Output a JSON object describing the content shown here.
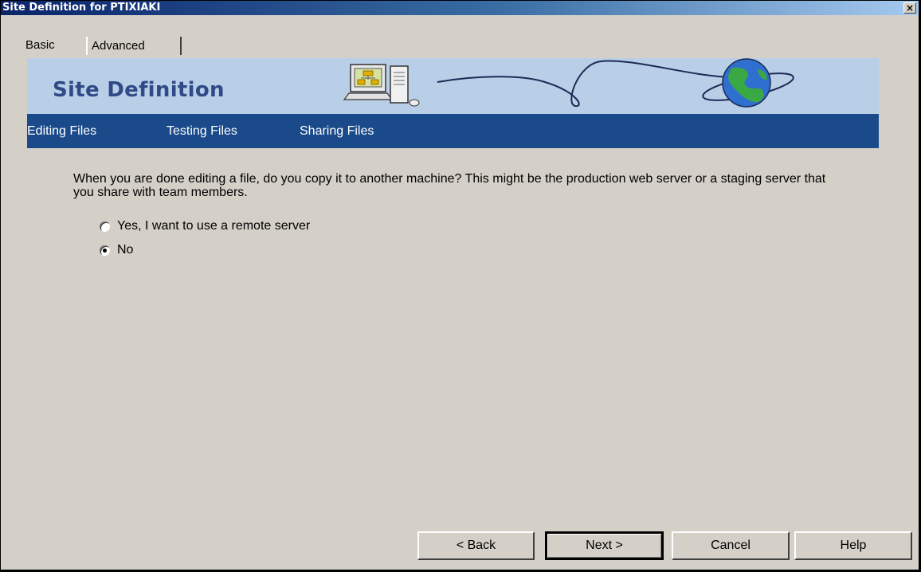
{
  "window": {
    "title": "Site Definition for PTIXIAKI",
    "close_label": "×"
  },
  "tabs": [
    {
      "label": "Basic",
      "active": true
    },
    {
      "label": "Advanced",
      "active": false
    }
  ],
  "banner": {
    "title": "Site Definition"
  },
  "nav": {
    "items": [
      "Editing Files",
      "Testing Files",
      "Sharing Files"
    ]
  },
  "content": {
    "question": "When you are done editing a file, do you copy it to another machine? This might be the production web server or a staging server that you share with team members.",
    "options": [
      {
        "label": "Yes, I want to use a remote server",
        "checked": false
      },
      {
        "label": "No",
        "checked": true
      }
    ]
  },
  "buttons": {
    "back": "< Back",
    "next": "Next >",
    "cancel": "Cancel",
    "help": "Help"
  },
  "colors": {
    "titlebar_start": "#0a246a",
    "banner_bg": "#b9cfe8",
    "nav_bg": "#1a4a8a",
    "dialog_bg": "#d4d0c8"
  }
}
